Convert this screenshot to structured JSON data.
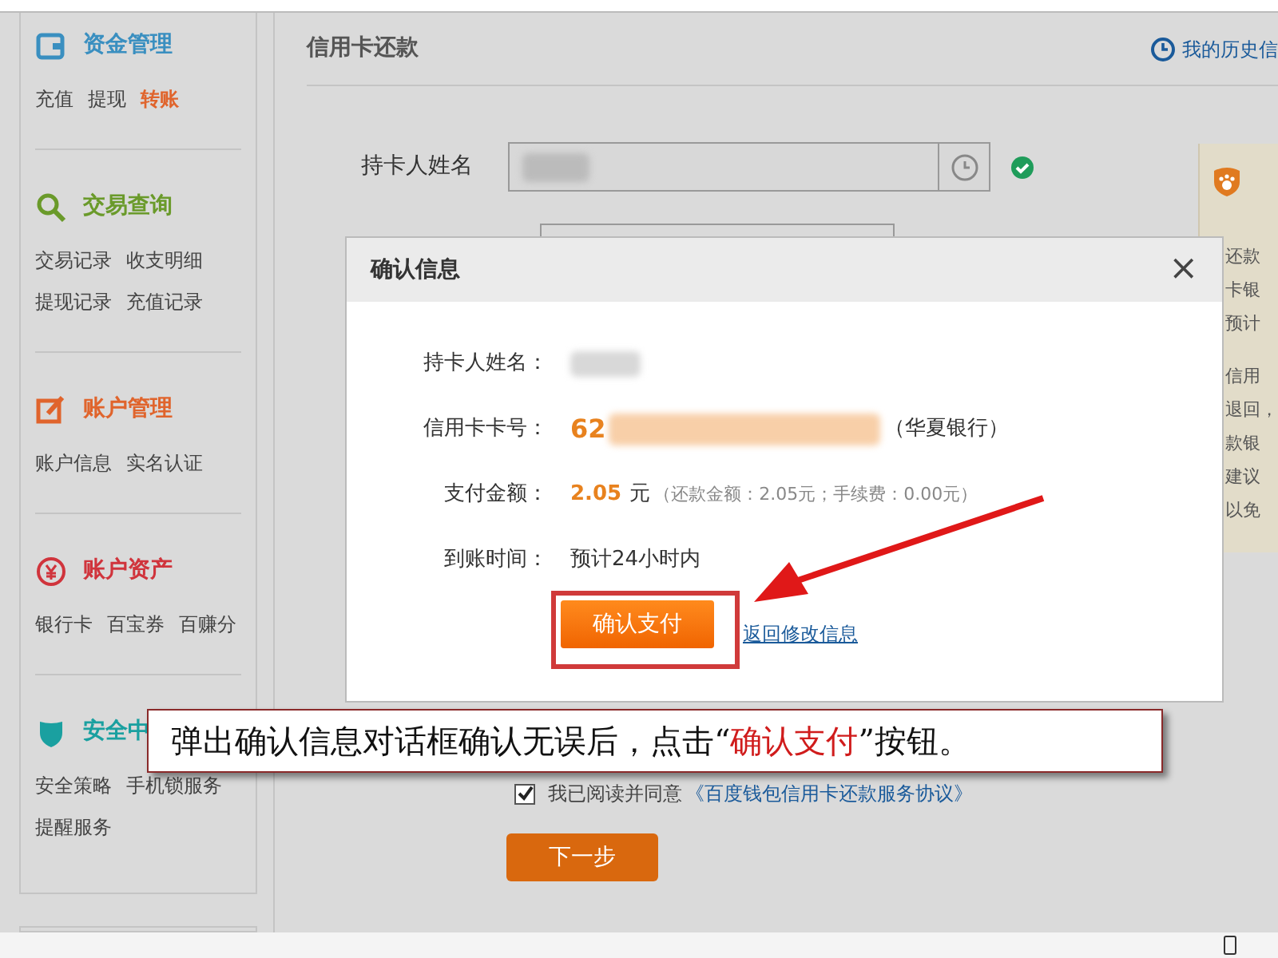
{
  "sidebar": {
    "sections": [
      {
        "title": "资金管理",
        "color": "#3a8fc0",
        "items": [
          [
            {
              "label": "充值",
              "selected": false
            },
            {
              "label": "提现",
              "selected": false
            },
            {
              "label": "转账",
              "selected": true
            }
          ]
        ]
      },
      {
        "title": "交易查询",
        "color": "#6a9a2a",
        "items": [
          [
            {
              "label": "交易记录",
              "selected": false
            },
            {
              "label": "收支明细",
              "selected": false
            }
          ],
          [
            {
              "label": "提现记录",
              "selected": false
            },
            {
              "label": "充值记录",
              "selected": false
            }
          ]
        ]
      },
      {
        "title": "账户管理",
        "color": "#e0642c",
        "items": [
          [
            {
              "label": "账户信息",
              "selected": false
            },
            {
              "label": "实名认证",
              "selected": false
            }
          ]
        ]
      },
      {
        "title": "账户资产",
        "color": "#d0343c",
        "items": [
          [
            {
              "label": "银行卡",
              "selected": false
            },
            {
              "label": "百宝券",
              "selected": false
            },
            {
              "label": "百赚分",
              "selected": false
            }
          ]
        ]
      },
      {
        "title": "安全中",
        "color": "#1aa0a0",
        "items": [
          [
            {
              "label": "安全策略",
              "selected": false
            },
            {
              "label": "手机锁服务",
              "selected": false
            }
          ],
          [
            {
              "label": "提醒服务",
              "selected": false
            }
          ]
        ]
      }
    ]
  },
  "main": {
    "title": "信用卡还款",
    "history_link": "我的历史信",
    "form": {
      "label": "持卡人姓名",
      "verified": true
    },
    "side_panel": {
      "lines": [
        "还款",
        "卡银",
        "预计",
        "信用",
        "退回，",
        "款银",
        "建议",
        "以免"
      ]
    },
    "agreement": {
      "checked": true,
      "text": "我已阅读并同意",
      "link": "《百度钱包信用卡还款服务协议》"
    },
    "next_button": "下一步"
  },
  "dialog": {
    "title": "确认信息",
    "close": "×",
    "rows": [
      {
        "kind": "name",
        "label": "持卡人姓名："
      },
      {
        "kind": "card",
        "label": "信用卡卡号：",
        "value": "62",
        "bank": "（华夏银行）"
      },
      {
        "kind": "amount",
        "label": "支付金额：",
        "value": "2.05",
        "unit": "元",
        "detail": "（还款金额：2.05元；手续费：0.00元）"
      },
      {
        "kind": "text",
        "label": "到账时间：",
        "value": "预计24小时内"
      }
    ],
    "confirm_button": "确认支付",
    "back_link": "返回修改信息"
  },
  "caption": {
    "before": "弹出确认信息对话框确认无误后，点击“",
    "highlight": "确认支付",
    "after": "”按钮。"
  }
}
